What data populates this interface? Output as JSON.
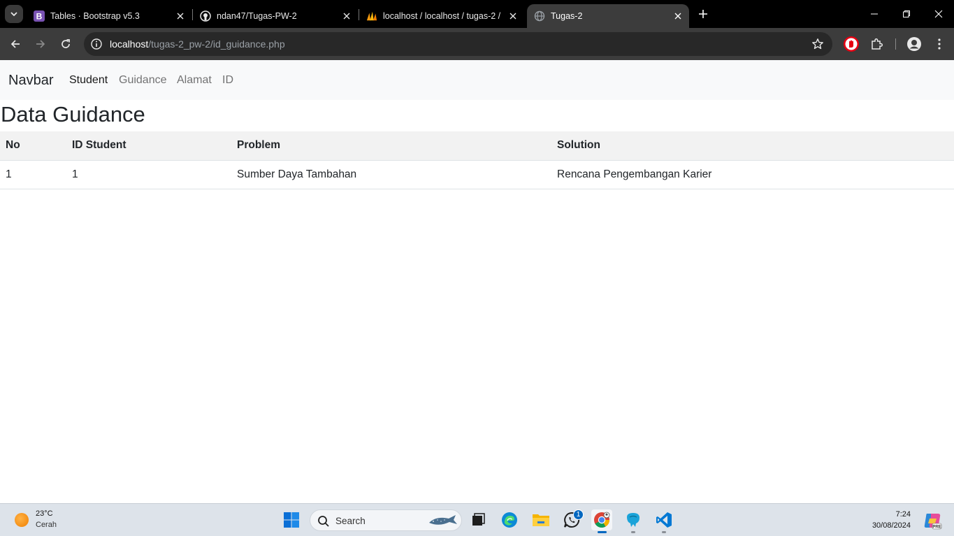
{
  "browser": {
    "tabs": [
      {
        "title": "Tables · Bootstrap v5.3",
        "favicon": "bootstrap-icon",
        "active": false
      },
      {
        "title": "ndan47/Tugas-PW-2",
        "favicon": "github-icon",
        "active": false
      },
      {
        "title": "localhost / localhost / tugas-2 / ",
        "favicon": "phpmyadmin-icon",
        "active": false
      },
      {
        "title": "Tugas-2",
        "favicon": "globe-icon",
        "active": true
      }
    ],
    "address": {
      "host": "localhost",
      "path": "/tugas-2_pw-2/id_guidance.php"
    }
  },
  "navbar": {
    "brand": "Navbar",
    "links": [
      {
        "label": "Student",
        "active": true
      },
      {
        "label": "Guidance",
        "active": false
      },
      {
        "label": "Alamat",
        "active": false
      },
      {
        "label": "ID",
        "active": false
      }
    ]
  },
  "page": {
    "title": "Data Guidance"
  },
  "table": {
    "headers": [
      "No",
      "ID Student",
      "Problem",
      "Solution"
    ],
    "rows": [
      [
        "1",
        "1",
        "Sumber Daya Tambahan",
        "Rencana Pengembangan Karier"
      ]
    ]
  },
  "taskbar": {
    "weather": {
      "temp": "23°C",
      "desc": "Cerah"
    },
    "search_placeholder": "Search",
    "whatsapp_badge": "1",
    "clock": {
      "time": "7:24",
      "date": "30/08/2024"
    },
    "pinned": [
      "windows-start-icon",
      "search-icon",
      "task-view-icon",
      "edge-icon",
      "file-explorer-icon",
      "whatsapp-icon",
      "chrome-icon",
      "mysql-icon",
      "vscode-icon",
      "copilot-icon"
    ]
  },
  "colors": {
    "brand_bootstrap": "#7952b3",
    "accent_taskbar": "#0067c0",
    "navbar_bg": "#f8f9fa"
  }
}
